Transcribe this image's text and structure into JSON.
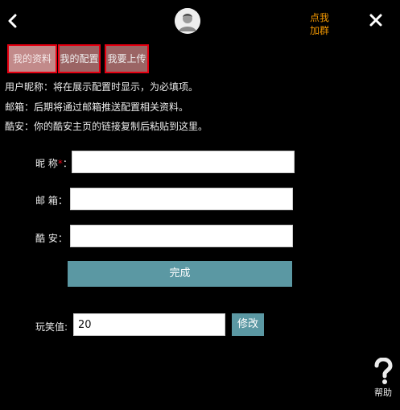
{
  "header": {
    "back_icon": "chevron-left-icon",
    "avatar_icon": "user-avatar-icon",
    "join_line1": "点我",
    "join_line2": "加群",
    "close_icon": "close-icon"
  },
  "tabs": [
    {
      "label": "我的资料"
    },
    {
      "label": "我的配置"
    },
    {
      "label": "我要上传"
    }
  ],
  "info": [
    "用户昵称：将在展示配置时显示，为必填项。",
    "邮箱：后期将通过邮箱推送配置相关资料。",
    "酷安：你的酷安主页的链接复制后粘贴到这里。"
  ],
  "form": {
    "nickname_label": "昵 称",
    "required_mark": "*",
    "nickname_colon": "：",
    "nickname_value": "",
    "email_label": "邮 箱：",
    "email_value": "",
    "coolapk_label": "酷 安：",
    "coolapk_value": "",
    "submit_label": "完成"
  },
  "joke": {
    "label": "玩笑值:",
    "value": "20",
    "edit_label": "修改"
  },
  "help": {
    "icon": "question-mark-icon",
    "label": "帮助"
  },
  "colors": {
    "accent": "#5b98a3",
    "join_link": "#f39800",
    "tab_border": "#e60012",
    "background": "#000000"
  }
}
